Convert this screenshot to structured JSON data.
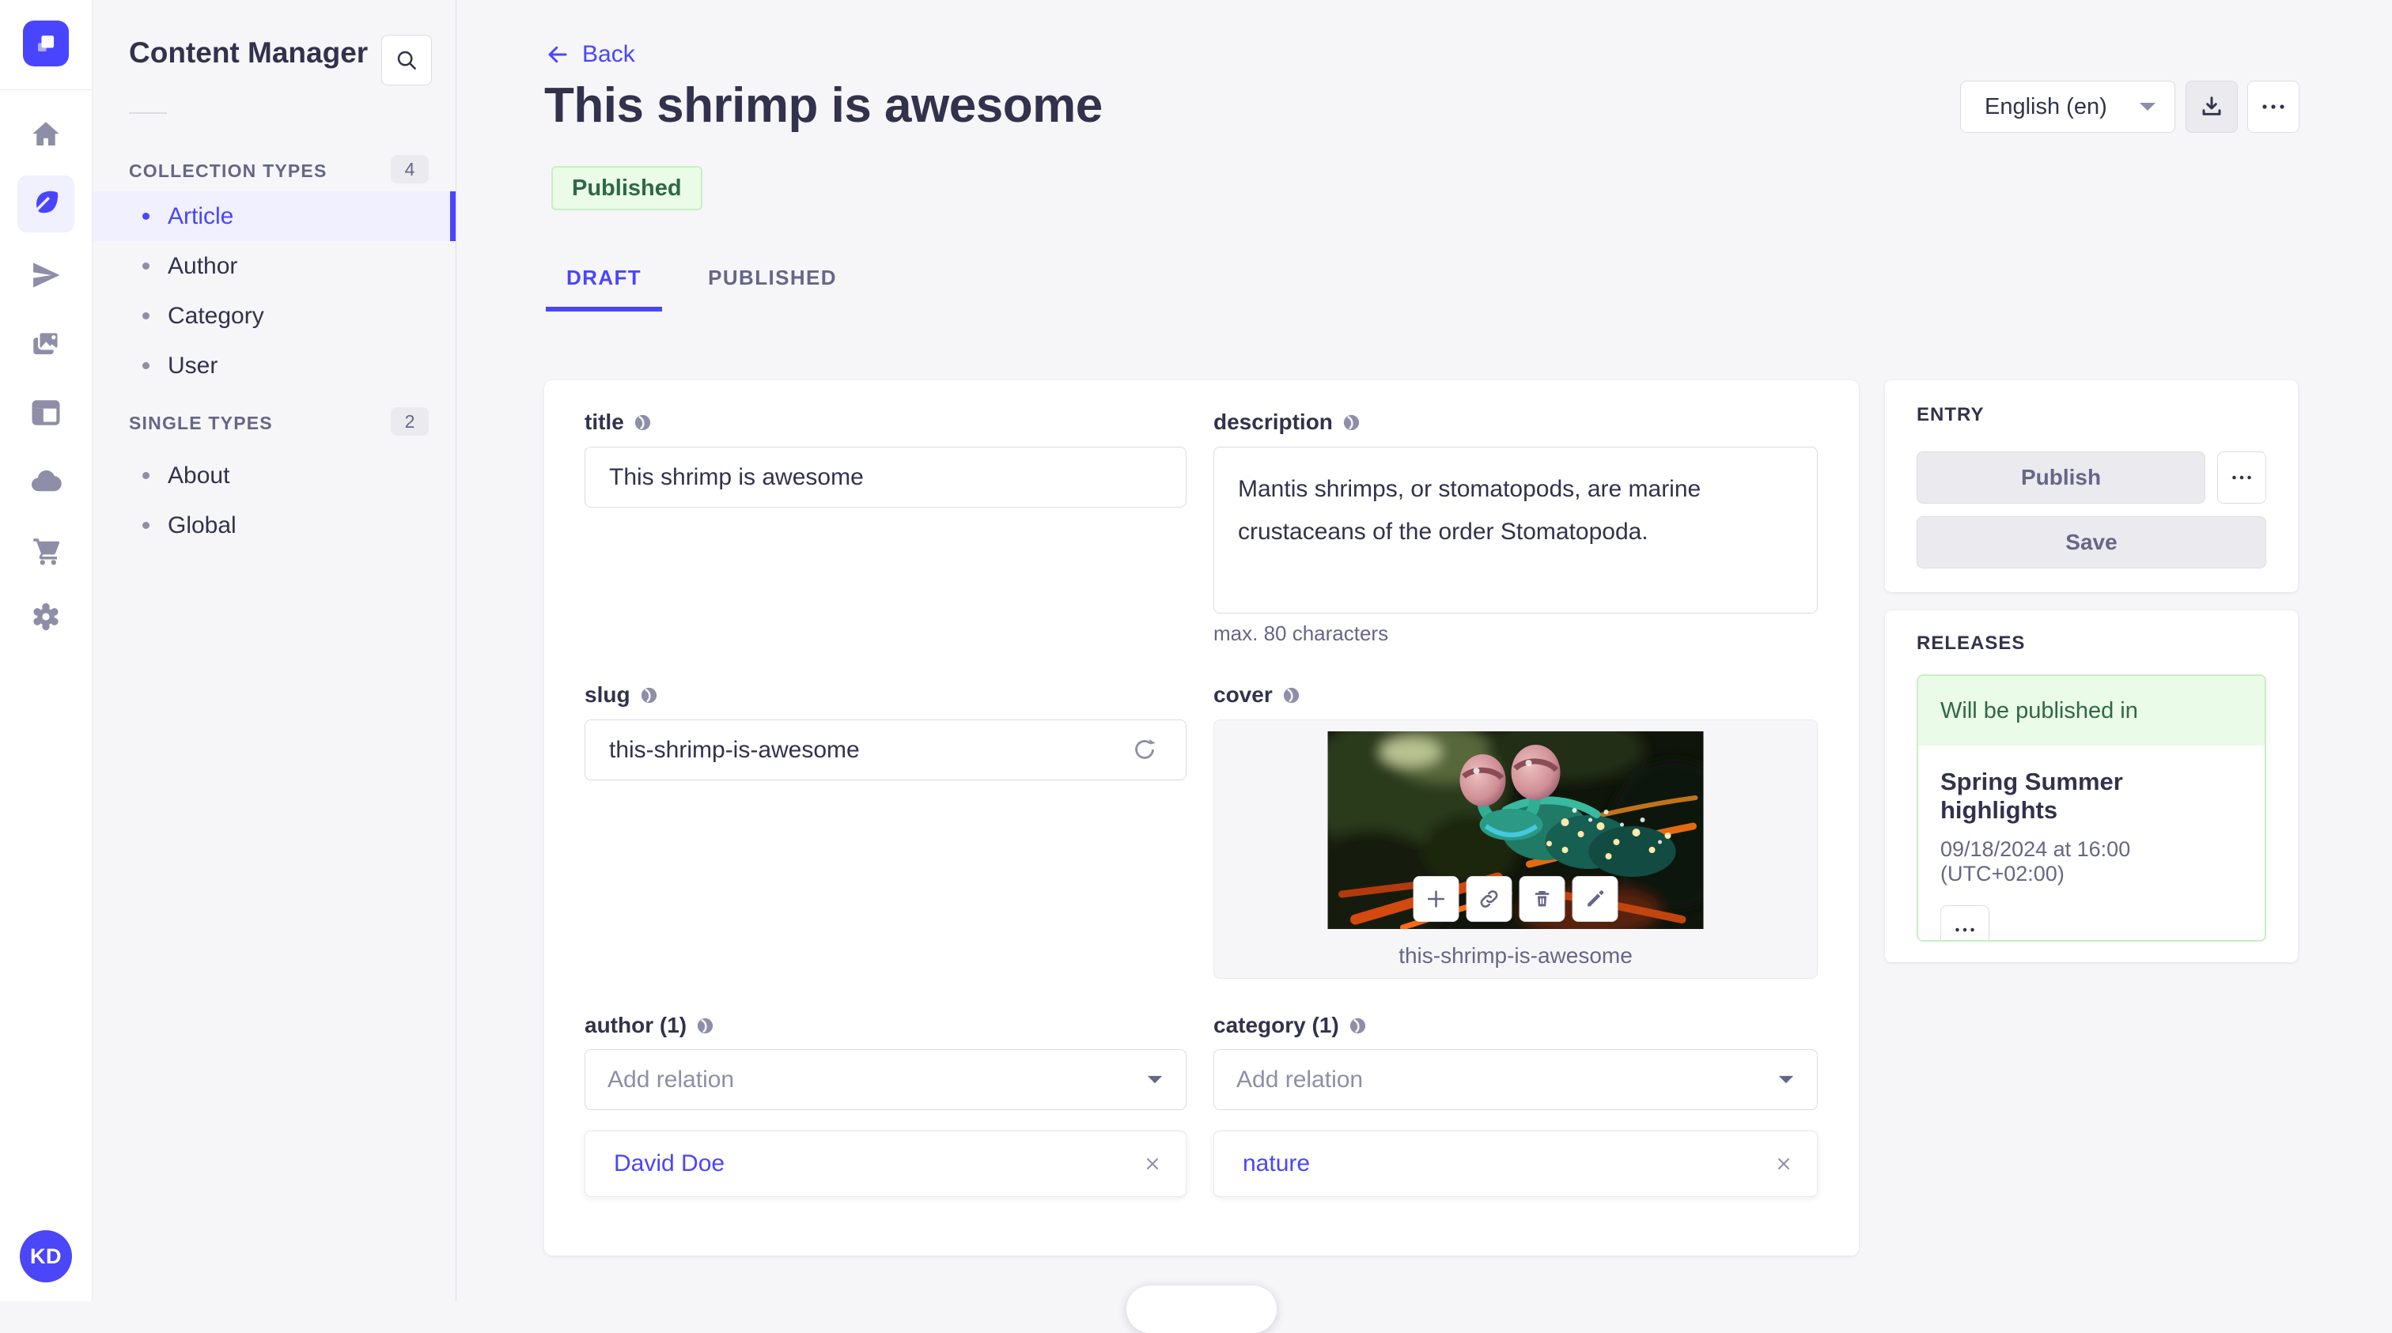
{
  "rail": {
    "logo_icon": "strapi-logo",
    "items": [
      {
        "icon": "home-icon"
      },
      {
        "icon": "content-manager-feather-icon",
        "active": true
      },
      {
        "icon": "release-plane-icon"
      },
      {
        "icon": "media-library-images-icon"
      },
      {
        "icon": "content-type-builder-layout-icon"
      },
      {
        "icon": "deploy-cloud-icon"
      },
      {
        "icon": "marketplace-cart-icon"
      },
      {
        "icon": "settings-gear-icon"
      }
    ],
    "avatar_initials": "KD"
  },
  "sidebar": {
    "title": "Content Manager",
    "sections": [
      {
        "label": "COLLECTION TYPES",
        "badge": "4",
        "items": [
          {
            "label": "Article",
            "active": true
          },
          {
            "label": "Author"
          },
          {
            "label": "Category"
          },
          {
            "label": "User"
          }
        ]
      },
      {
        "label": "SINGLE TYPES",
        "badge": "2",
        "items": [
          {
            "label": "About"
          },
          {
            "label": "Global"
          }
        ]
      }
    ]
  },
  "header": {
    "back_label": "Back",
    "title": "This shrimp is awesome",
    "status_badge": "Published",
    "locale_selected": "English (en)",
    "tabs": [
      {
        "label": "DRAFT",
        "active": true
      },
      {
        "label": "PUBLISHED"
      }
    ]
  },
  "form": {
    "title": {
      "label": "title",
      "value": "This shrimp is awesome"
    },
    "description": {
      "label": "description",
      "value": "Mantis shrimps, or stomatopods, are marine crustaceans of the order Stomatopoda.",
      "helper": "max. 80 characters"
    },
    "slug": {
      "label": "slug",
      "value": "this-shrimp-is-awesome"
    },
    "cover": {
      "label": "cover",
      "filename": "this-shrimp-is-awesome"
    },
    "author": {
      "label": "author (1)",
      "placeholder": "Add relation",
      "relations": [
        {
          "name": "David Doe"
        }
      ]
    },
    "category": {
      "label": "category (1)",
      "placeholder": "Add relation",
      "relations": [
        {
          "name": "nature"
        }
      ]
    }
  },
  "entry_panel": {
    "heading": "ENTRY",
    "publish_label": "Publish",
    "save_label": "Save"
  },
  "releases_panel": {
    "heading": "RELEASES",
    "status": "Will be published in",
    "release_title": "Spring Summer highlights",
    "release_date": "09/18/2024 at 16:00 (UTC+02:00)"
  },
  "colors": {
    "primary": "#4945ff",
    "primary_bg": "#f0f0ff",
    "success_text": "#2f6846",
    "success_bg": "#eafbe7",
    "success_border": "#c6f0c2",
    "text": "#32324d",
    "text_muted": "#666687",
    "placeholder": "#8e8ea9",
    "border": "#dcdce4",
    "page_bg": "#f6f6f9"
  }
}
